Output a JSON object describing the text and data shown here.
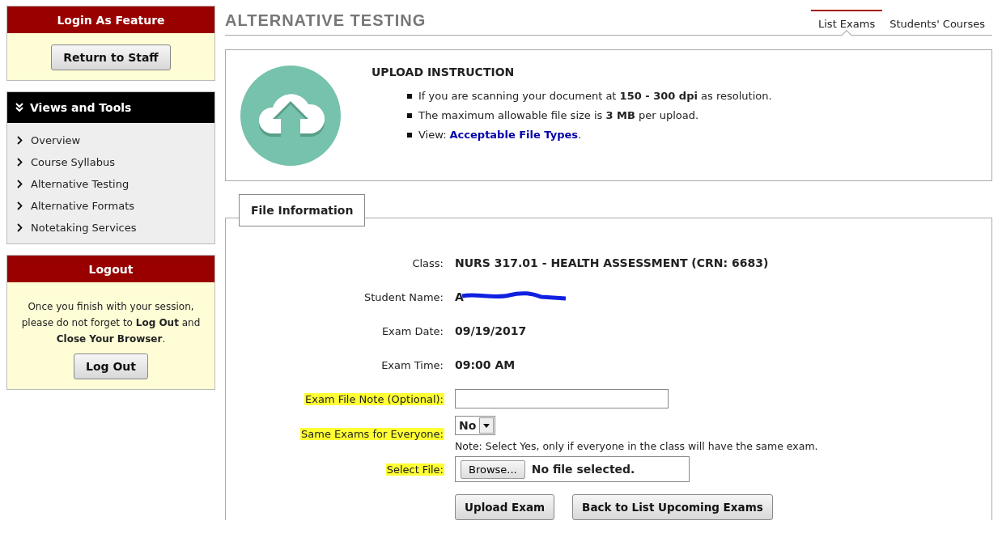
{
  "sidebar": {
    "login_as": {
      "title": "Login As Feature",
      "button": "Return to Staff"
    },
    "views": {
      "title": "Views and Tools",
      "items": [
        {
          "label": "Overview"
        },
        {
          "label": "Course Syllabus"
        },
        {
          "label": "Alternative Testing"
        },
        {
          "label": "Alternative Formats"
        },
        {
          "label": "Notetaking Services"
        }
      ]
    },
    "logout": {
      "title": "Logout",
      "message": "Once you finish with your session, please do not forget to **Log Out** and **Close Your Browser**.",
      "button": "Log Out"
    }
  },
  "page": {
    "title": "ALTERNATIVE TESTING",
    "tabs": [
      {
        "label": "List Exams",
        "selected": true
      },
      {
        "label": "Students' Courses",
        "selected": false
      }
    ]
  },
  "upload_instruction": {
    "title": "UPLOAD INSTRUCTION",
    "bullets": [
      "If you are scanning your document at **150 - 300 dpi** as resolution.",
      "The maximum allowable file size is **3 MB** per upload."
    ],
    "view_label": "View:",
    "view_link": "Acceptable File Types",
    "view_end": "."
  },
  "file_information": {
    "legend": "File Information",
    "rows": [
      {
        "kind": "text",
        "label": "Class:",
        "value": "NURS 317.01 - HEALTH ASSESSMENT (CRN: 6683)",
        "highlighted": false
      },
      {
        "kind": "redacted",
        "label": "Student Name:",
        "value": "A",
        "highlighted": false
      },
      {
        "kind": "text",
        "label": "Exam Date:",
        "value": "09/19/2017",
        "highlighted": false
      },
      {
        "kind": "text",
        "label": "Exam Time:",
        "value": "09:00 AM",
        "highlighted": false
      },
      {
        "kind": "input",
        "label": "Exam File Note (Optional):",
        "highlighted": true
      },
      {
        "kind": "select",
        "label": "Same Exams for Everyone:",
        "value": "No",
        "note": "Note: Select Yes, only if everyone in the class will have the same exam.",
        "highlighted": true
      },
      {
        "kind": "file",
        "label": "Select File:",
        "button": "Browse...",
        "value": "No file selected.",
        "highlighted": true
      }
    ],
    "buttons": [
      "Upload Exam",
      "Back to List Upcoming Exams"
    ]
  }
}
